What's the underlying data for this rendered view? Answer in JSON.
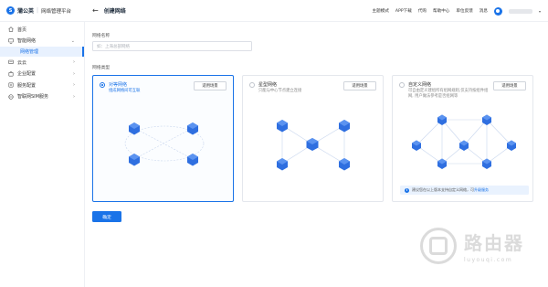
{
  "brand": {
    "logo_text": "S",
    "name": "蒲公英",
    "separator": "|",
    "subtitle": "网络管理平台"
  },
  "header": {
    "back_icon": "arrow-left-icon",
    "title": "创建网络"
  },
  "topnav": {
    "items": [
      "主题模式",
      "APP下载",
      "代购",
      "帮助中心",
      "单位反馈",
      "消息"
    ],
    "username": "",
    "caret": "▾"
  },
  "sidebar": {
    "items": [
      {
        "label": "首页",
        "icon": "home-icon",
        "chevron": ""
      },
      {
        "label": "智能网络",
        "icon": "network-icon",
        "chevron": "⌄"
      },
      {
        "label": "网络管理",
        "sub": true
      },
      {
        "label": "云云",
        "icon": "cloud-icon",
        "chevron": "›"
      },
      {
        "label": "企业配置",
        "icon": "enterprise-icon",
        "chevron": "›"
      },
      {
        "label": "服务配置",
        "icon": "service-icon",
        "chevron": "›"
      },
      {
        "label": "智联网SIM服务",
        "icon": "sim-icon",
        "chevron": "›"
      }
    ]
  },
  "form": {
    "name_label": "网络名称",
    "name_placeholder": "如：上海总部网络",
    "type_label": "网络类型"
  },
  "cards": [
    {
      "title": "对等网络",
      "desc": "组成网络间可互联",
      "button": "适用场景",
      "selected": true
    },
    {
      "title": "星型网络",
      "desc": "只能与中心节点建立连接",
      "button": "适用场景",
      "selected": false
    },
    {
      "title": "自定义网络",
      "desc": "可自由定义建组所有组网规则,仅支持按组件组网, 用户做法参考是否组网等",
      "button": "适用场景",
      "selected": false
    }
  ],
  "tip": {
    "icon": "info-icon",
    "icon_glyph": "i",
    "text": "建议您在以上版本支持自定义网络，可",
    "link": "升级服务"
  },
  "confirm_label": "确定",
  "watermark": {
    "main": "路由器",
    "sub": "luyouqi.com"
  },
  "colors": {
    "accent": "#1a73e8",
    "node": "#2f6fe0",
    "node_light": "#5b93f0"
  }
}
